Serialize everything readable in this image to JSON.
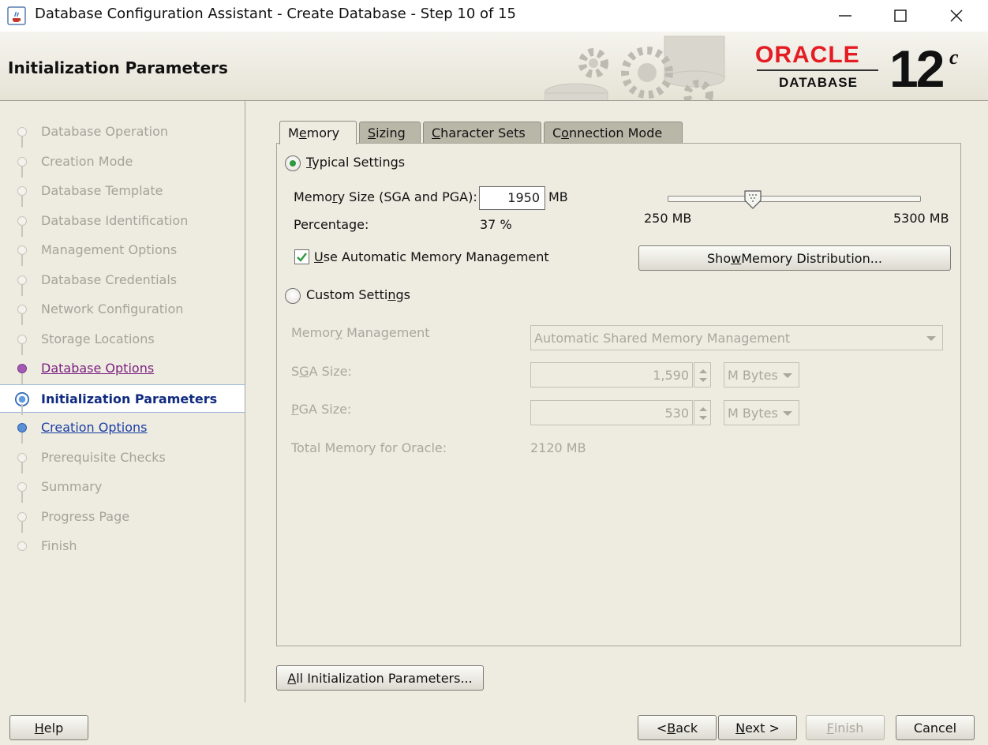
{
  "window": {
    "title": "Database Configuration Assistant - Create Database - Step 10 of 15",
    "app_icon": "java-cup-icon",
    "controls": [
      "minimize-icon",
      "maximize-icon",
      "close-icon"
    ]
  },
  "header": {
    "page_title": "Initialization Parameters",
    "brand": "ORACLE",
    "product": "DATABASE",
    "version": "12",
    "version_suffix": "c",
    "brand_color": "#e51c23"
  },
  "steps": [
    {
      "label": "Database Operation",
      "state": "done"
    },
    {
      "label": "Creation Mode",
      "state": "done"
    },
    {
      "label": "Database Template",
      "state": "done"
    },
    {
      "label": "Database Identification",
      "state": "done"
    },
    {
      "label": "Management Options",
      "state": "done"
    },
    {
      "label": "Database Credentials",
      "state": "done"
    },
    {
      "label": "Network Configuration",
      "state": "done"
    },
    {
      "label": "Storage Locations",
      "state": "done"
    },
    {
      "label": "Database Options",
      "state": "visited"
    },
    {
      "label": "Initialization Parameters",
      "state": "current"
    },
    {
      "label": "Creation Options",
      "state": "link"
    },
    {
      "label": "Prerequisite Checks",
      "state": "pending"
    },
    {
      "label": "Summary",
      "state": "pending"
    },
    {
      "label": "Progress Page",
      "state": "pending"
    },
    {
      "label": "Finish",
      "state": "pending"
    }
  ],
  "tabs": [
    {
      "pre": "M",
      "key": "e",
      "post": "mory",
      "active": true
    },
    {
      "pre": "",
      "key": "S",
      "post": "izing",
      "active": false
    },
    {
      "pre": "",
      "key": "C",
      "post": "haracter Sets",
      "active": false
    },
    {
      "pre": "C",
      "key": "o",
      "post": "nnection Mode",
      "active": false
    }
  ],
  "memory": {
    "typical": {
      "pre": "",
      "key": "T",
      "post": "ypical Settings",
      "selected": true,
      "size_label_pre": "Memo",
      "size_label_key": "r",
      "size_label_post": "y Size (SGA and PGA):",
      "size_value": "1950",
      "size_unit": "MB",
      "percentage_label": "Percentage:",
      "percentage_value": "37 %",
      "slider_min_label": "250 MB",
      "slider_max_label": "5300 MB",
      "slider_min": 250,
      "slider_max": 5300,
      "slider_value": 1950,
      "amm_pre": "",
      "amm_key": "U",
      "amm_post": "se Automatic Memory Management",
      "amm_checked": true,
      "show_dist_pre": "Sho",
      "show_dist_key": "w",
      "show_dist_post": " Memory Distribution..."
    },
    "custom": {
      "pre": "Custom Setti",
      "key": "n",
      "post": "gs",
      "selected": false,
      "mm_label_pre": "Memor",
      "mm_label_key": "y",
      "mm_label_post": " Management",
      "mm_value": "Automatic Shared Memory Management",
      "sga_label_pre": "S",
      "sga_label_key": "G",
      "sga_label_post": "A Size:",
      "sga_value": "1,590",
      "sga_unit": "M Bytes",
      "pga_label_pre": "",
      "pga_label_key": "P",
      "pga_label_post": "GA Size:",
      "pga_value": "530",
      "pga_unit": "M Bytes",
      "total_label": "Total Memory for Oracle:",
      "total_value": "2120 MB"
    }
  },
  "all_params": {
    "pre": "",
    "key": "A",
    "post": "ll Initialization Parameters..."
  },
  "footer": {
    "help": {
      "pre": "",
      "key": "H",
      "post": "elp"
    },
    "back": {
      "pre": "< ",
      "key": "B",
      "post": "ack"
    },
    "next": {
      "pre": "",
      "key": "N",
      "post": "ext >"
    },
    "finish": {
      "pre": "",
      "key": "F",
      "post": "inish"
    },
    "cancel": {
      "pre": "Cancel",
      "key": "",
      "post": ""
    }
  }
}
